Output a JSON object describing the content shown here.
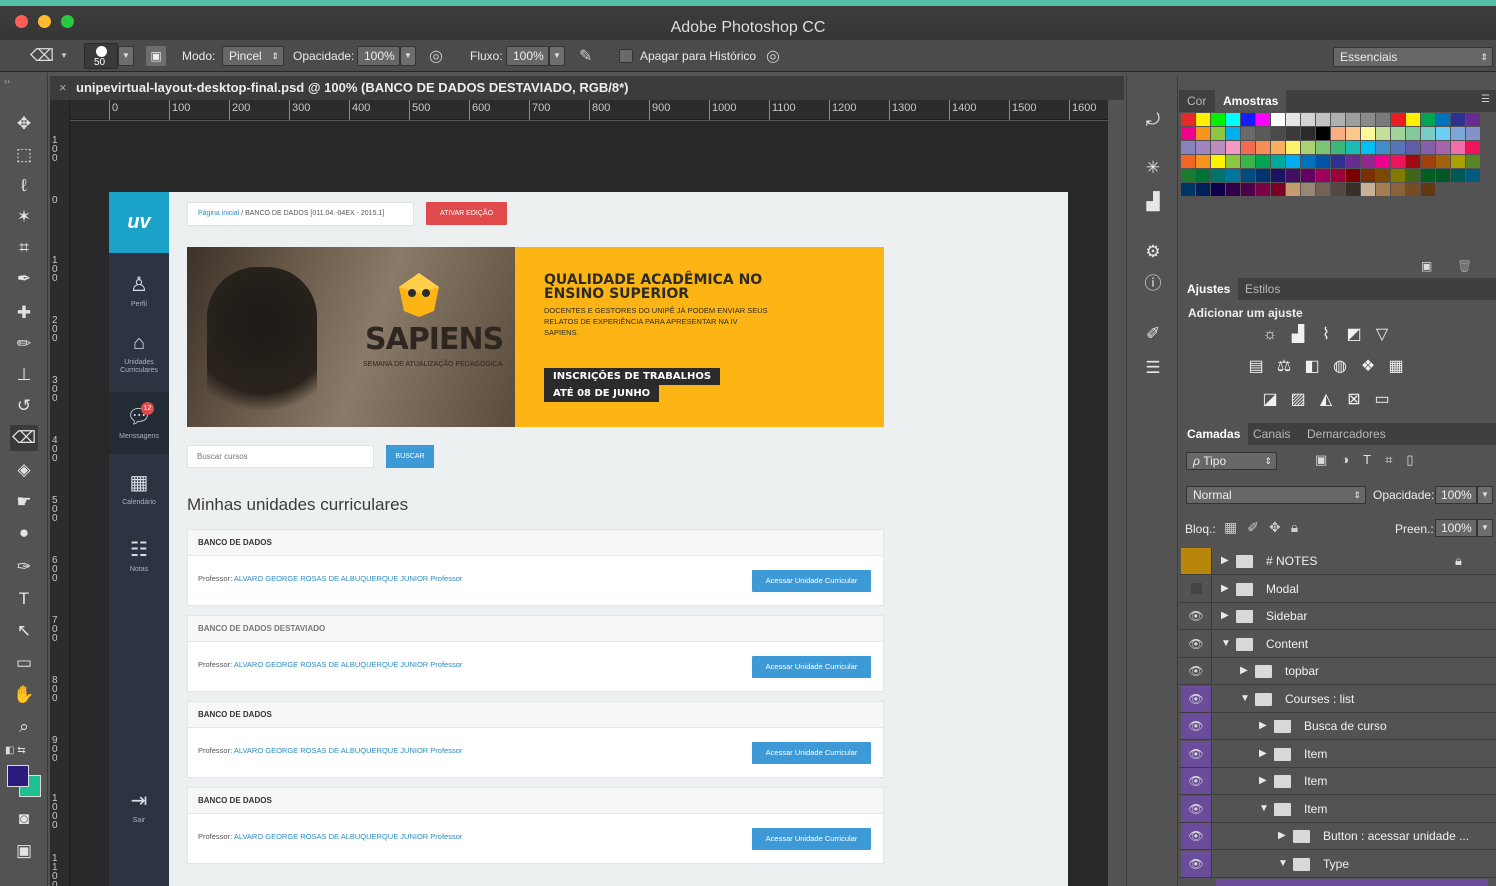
{
  "window": {
    "title": "Adobe Photoshop CC"
  },
  "options_bar": {
    "brush_size": "50",
    "mode_label": "Modo:",
    "mode_value": "Pincel",
    "opacity_label": "Opacidade:",
    "opacity_value": "100%",
    "flow_label": "Fluxo:",
    "flow_value": "100%",
    "history_label": "Apagar para Histórico",
    "workspace_value": "Essenciais"
  },
  "document": {
    "tab_title": "unipevirtual-layout-desktop-final.psd @ 100% (BANCO DE DADOS DESTAVIADO, RGB/8*)",
    "ruler_top": [
      "0",
      "100",
      "200",
      "300",
      "400",
      "500",
      "600",
      "700",
      "800",
      "900",
      "1000",
      "1100",
      "1200",
      "1300",
      "1400",
      "1500",
      "1600"
    ],
    "ruler_left": [
      "100",
      "0",
      "100",
      "200",
      "300",
      "400",
      "500",
      "600",
      "700",
      "800",
      "900",
      "1000",
      "1100"
    ]
  },
  "website": {
    "logo": "uv",
    "sidebar": [
      {
        "label": "Perfil",
        "icon": "user-icon"
      },
      {
        "label": "Unidades Curriculares",
        "icon": "graduation-cap-icon"
      },
      {
        "label": "Menssagens",
        "icon": "chat-icon",
        "badge": "12"
      },
      {
        "label": "Calendário",
        "icon": "calendar-icon"
      },
      {
        "label": "Notas",
        "icon": "notes-icon"
      },
      {
        "label": "Sair",
        "icon": "exit-icon"
      }
    ],
    "breadcrumb_home": "Página inicial",
    "breadcrumb_rest": " / BANCO DE DADOS [011.04.-04EX - 2015.1]",
    "activate_button": "ATIVAR EDIÇÃO",
    "banner": {
      "brand": "SAPIENS",
      "brand_sub": "SEMANA DE ATUALIZAÇÃO PEDAGÓGICA",
      "headline": "QUALIDADE ACADÊMICA NO ENSINO SUPERIOR",
      "body": "DOCENTES E GESTORES DO UNIPÊ JÁ PODEM ENVIAR SEUS RELATOS DE EXPERIÊNCIA PARA APRESENTAR NA IV SAPIENS.",
      "tag1": "INSCRIÇÕES DE TRABALHOS",
      "tag2": "ATÉ 08 DE JUNHO"
    },
    "search_placeholder": "Buscar cursos",
    "search_button": "BUSCAR",
    "section_title": "Minhas unidades curriculares",
    "courses": [
      {
        "title": "BANCO DE DADOS",
        "prof_label": "Professor:",
        "prof_name": "ALVARO GEORGE ROSAS DE ALBUQUERQUE JUNIOR Professor",
        "button": "Acessar Unidade Curricular"
      },
      {
        "title": "BANCO DE DADOS DESTAVIADO",
        "prof_label": "Professor:",
        "prof_name": "ALVARO GEORGE ROSAS DE ALBUQUERQUE JUNIOR Professor",
        "button": "Acessar Unidade Curricular"
      },
      {
        "title": "BANCO DE DADOS",
        "prof_label": "Professor:",
        "prof_name": "ALVARO GEORGE ROSAS DE ALBUQUERQUE JUNIOR Professor",
        "button": "Acessar Unidade Curricular"
      },
      {
        "title": "BANCO DE DADOS",
        "prof_label": "Professor:",
        "prof_name": "ALVARO GEORGE ROSAS DE ALBUQUERQUE JUNIOR Professor",
        "button": "Acessar Unidade Curricular"
      }
    ]
  },
  "panels": {
    "color_tabs": [
      "Cor",
      "Amostras"
    ],
    "adjust_tabs": [
      "Ajustes",
      "Estilos"
    ],
    "adjust_heading": "Adicionar um ajuste",
    "layer_tabs": [
      "Camadas",
      "Canais",
      "Demarcadores"
    ],
    "filter_kind": "Tipo",
    "blend_mode": "Normal",
    "opacity_label": "Opacidade:",
    "opacity_value": "100%",
    "lock_label": "Bloq.:",
    "fill_label": "Preen.:",
    "fill_value": "100%",
    "layers": [
      {
        "name": "# NOTES"
      },
      {
        "name": "Modal"
      },
      {
        "name": "Sidebar"
      },
      {
        "name": "Content"
      },
      {
        "name": "topbar"
      },
      {
        "name": "Courses : list"
      },
      {
        "name": "Busca de curso"
      },
      {
        "name": "Item"
      },
      {
        "name": "Item"
      },
      {
        "name": "Item"
      },
      {
        "name": "Button : acessar unidade ..."
      },
      {
        "name": "Type"
      }
    ]
  },
  "colors": {
    "accent_teal": "#55c0a9",
    "web_sidebar": "#2b3440",
    "web_logo": "#1aa2c9",
    "banner_yellow": "#fdb516",
    "button_blue": "#3e9ad6",
    "button_red": "#e04a4a",
    "layer_purple": "#6b4c9a"
  }
}
